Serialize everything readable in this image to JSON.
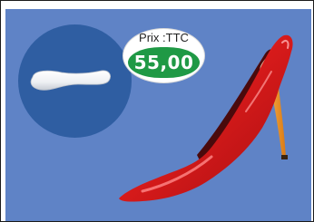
{
  "price_badge": {
    "label": "Prix :TTC",
    "price": "55,00"
  },
  "colors": {
    "background_panel": "#5f83c6",
    "circle": "#2f5ea2",
    "price_fill": "#1f9945",
    "shoe": "#d61a1a"
  },
  "icons": {
    "product": "heel-pad",
    "illustration": "red-high-heel-shoe"
  }
}
